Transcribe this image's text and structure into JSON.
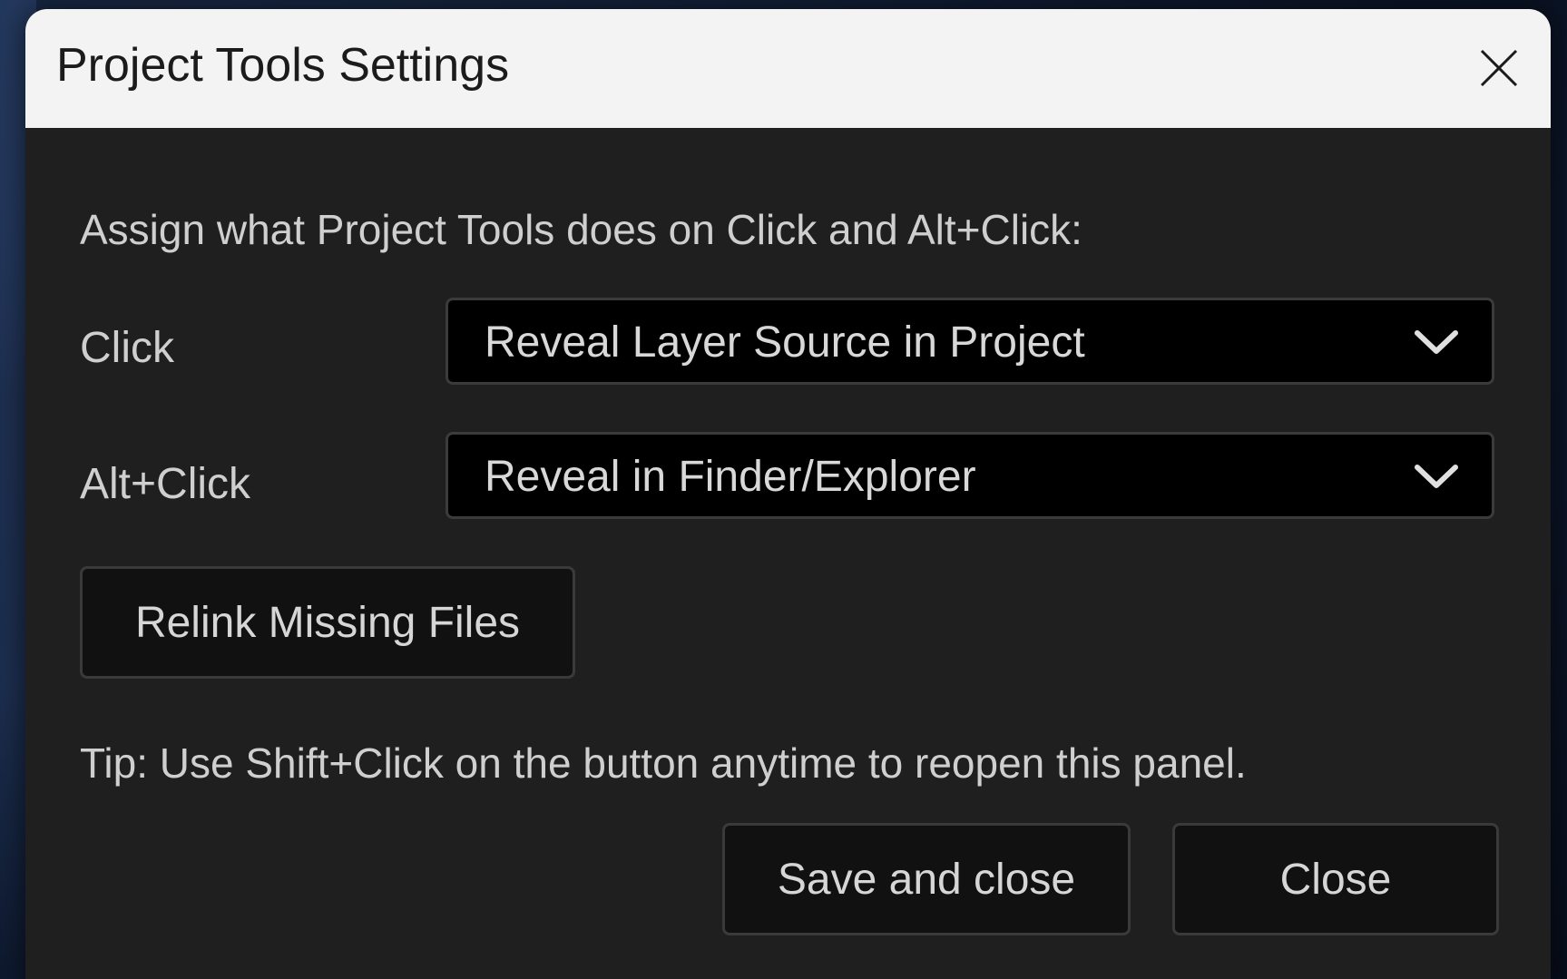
{
  "dialog": {
    "title": "Project Tools Settings",
    "close_icon": "close-icon"
  },
  "content": {
    "instruction": "Assign what Project Tools does on Click and Alt+Click:",
    "click_row": {
      "label": "Click",
      "selected_value": "Reveal Layer Source in Project"
    },
    "alt_click_row": {
      "label": "Alt+Click",
      "selected_value": "Reveal in Finder/Explorer"
    },
    "relink_button_label": "Relink Missing Files",
    "tip": "Tip: Use Shift+Click on the button anytime to reopen this panel."
  },
  "footer": {
    "save_label": "Save and close",
    "close_label": "Close"
  },
  "colors": {
    "title_bar_bg": "#f3f3f3",
    "dialog_bg": "#1f1f1f",
    "select_bg": "#000000",
    "button_bg": "#111111",
    "text": "#cfcfcf"
  }
}
